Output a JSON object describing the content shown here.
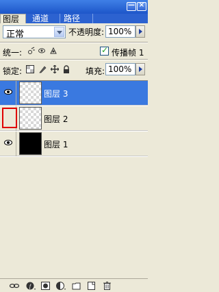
{
  "tabs": [
    {
      "label": "图层"
    },
    {
      "label": "通道"
    },
    {
      "label": "路径"
    }
  ],
  "controls": {
    "blend_mode": "正常",
    "opacity_label": "不透明度:",
    "opacity_value": "100%",
    "unify_label": "统一:",
    "propagate_label": "传播帧 1",
    "lock_label": "锁定:",
    "fill_label": "填充:",
    "fill_value": "100%"
  },
  "layers": [
    {
      "name": "图层 3",
      "visible": true,
      "selected": true,
      "thumb": "transparent"
    },
    {
      "name": "图层 2",
      "visible": false,
      "selected": false,
      "thumb": "transparent"
    },
    {
      "name": "图层 1",
      "visible": true,
      "selected": false,
      "thumb": "black"
    }
  ],
  "colors": {
    "selection": "#3a79e0",
    "highlight": "#e00000",
    "titlebar": "#2c62d0"
  }
}
